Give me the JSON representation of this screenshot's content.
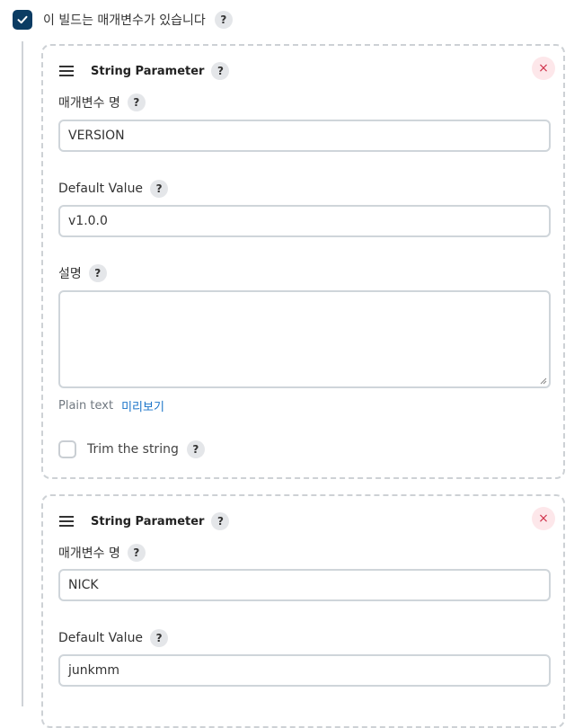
{
  "has_params": {
    "label": "이 빌드는 매개변수가 있습니다"
  },
  "help_glyph": "?",
  "close_glyph": "×",
  "params": [
    {
      "type_label": "String Parameter",
      "name_label": "매개변수 명",
      "name_value": "VERSION",
      "default_label": "Default Value",
      "default_value": "v1.0.0",
      "desc_label": "설명",
      "desc_value": "",
      "plain_text": "Plain text",
      "preview_link": "미리보기",
      "trim_label": "Trim the string"
    },
    {
      "type_label": "String Parameter",
      "name_label": "매개변수 명",
      "name_value": "NICK",
      "default_label": "Default Value",
      "default_value": "junkmm"
    }
  ],
  "colors": {
    "accent": "#0b3c63",
    "link": "#1a73c8",
    "danger": "#d0334c"
  }
}
